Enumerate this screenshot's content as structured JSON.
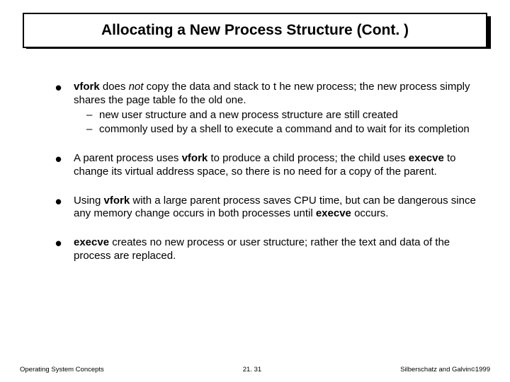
{
  "title": "Allocating a New Process Structure (Cont. )",
  "bullets": {
    "b1": {
      "pre": "vfork",
      "mid": " does ",
      "it": "not",
      "post": " copy the data and stack to t he new process; the new process simply shares the page table fo the old one.",
      "s1": "new user structure and a new process structure are still created",
      "s2": "commonly used by a shell to execute a command and to wait for its completion"
    },
    "b2": {
      "t1": "A parent process uses ",
      "k1": "vfork",
      "t2": " to produce a child process; the child uses ",
      "k2": "execve",
      "t3": " to change its virtual address space, so there is no need for a copy of the parent."
    },
    "b3": {
      "t1": "Using ",
      "k1": "vfork",
      "t2": " with a large parent process saves CPU time, but can be dangerous since any memory change occurs in both processes until ",
      "k2": "execve",
      "t3": " occurs."
    },
    "b4": {
      "k1": "execve",
      "t1": " creates no new process or user structure; rather the text and data of the process are replaced."
    }
  },
  "footer": {
    "left": "Operating System Concepts",
    "center": "21. 31",
    "right_a": "Silberschatz and Galvin",
    "right_b": "1999"
  }
}
